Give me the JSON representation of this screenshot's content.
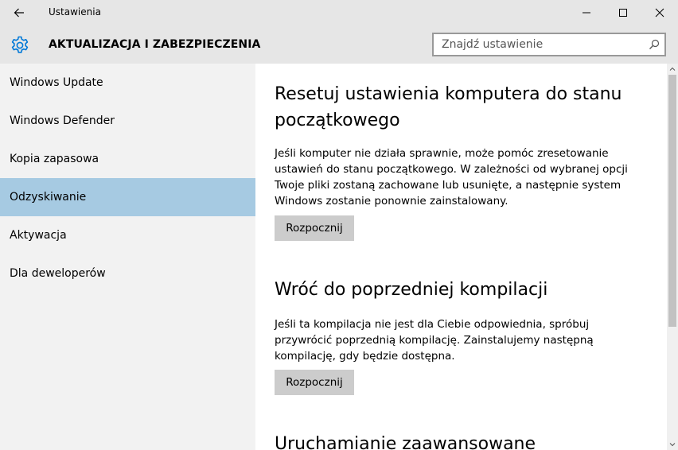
{
  "window": {
    "title": "Ustawienia"
  },
  "header": {
    "title": "AKTUALIZACJA I ZABEZPIECZENIA",
    "search_placeholder": "Znajdź ustawienie"
  },
  "sidebar": {
    "items": [
      {
        "label": "Windows Update"
      },
      {
        "label": "Windows Defender"
      },
      {
        "label": "Kopia zapasowa"
      },
      {
        "label": "Odzyskiwanie",
        "selected": true
      },
      {
        "label": "Aktywacja"
      },
      {
        "label": "Dla deweloperów"
      }
    ]
  },
  "content": {
    "sections": [
      {
        "title": "Resetuj ustawienia komputera do stanu początkowego",
        "description": "Jeśli komputer nie działa sprawnie, może pomóc zresetowanie ustawień do stanu początkowego. W zależności od wybranej opcji Twoje pliki zostaną zachowane lub usunięte, a następnie system Windows zostanie ponownie zainstalowany.",
        "button_label": "Rozpocznij"
      },
      {
        "title": "Wróć do poprzedniej kompilacji",
        "description": "Jeśli ta kompilacja nie jest dla Ciebie odpowiednia, spróbuj przywrócić poprzednią kompilację. Zainstalujemy następną kompilację, gdy będzie dostępna.",
        "button_label": "Rozpocznij"
      },
      {
        "title": "Uruchamianie zaawansowane"
      }
    ]
  },
  "colors": {
    "titlebar_bg": "#e6e6e6",
    "sidebar_bg": "#f2f2f2",
    "selected_bg": "#a6cae2",
    "accent": "#0078d7",
    "button_bg": "#cccccc"
  },
  "icons": {
    "back": "back-arrow-icon",
    "settings": "gear-icon",
    "search": "search-icon",
    "minimize": "minimize-icon",
    "maximize": "maximize-icon",
    "close": "close-icon"
  }
}
